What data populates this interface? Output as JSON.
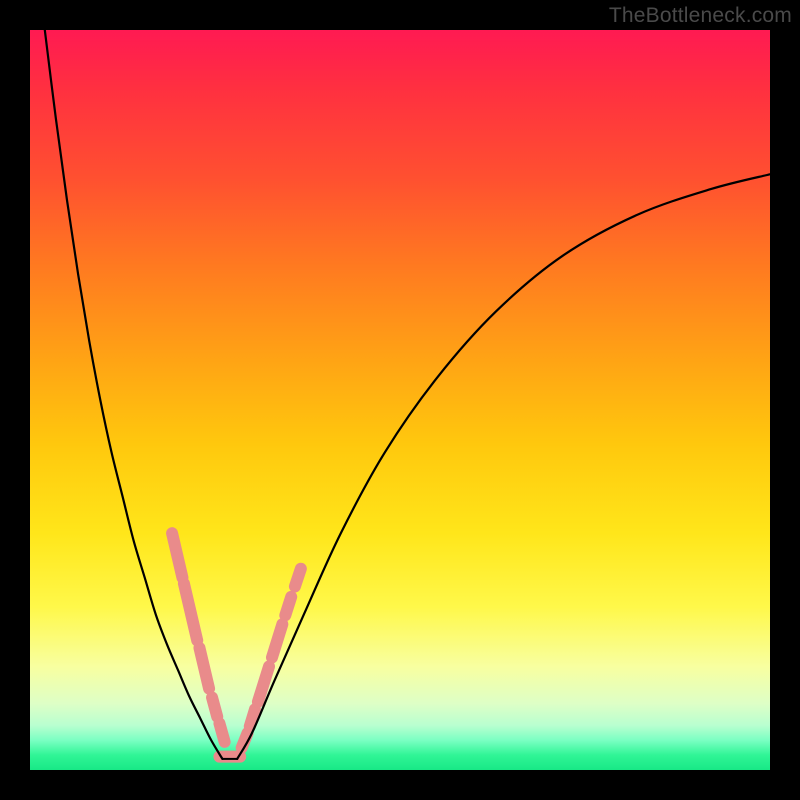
{
  "watermark": "TheBottleneck.com",
  "chart_data": {
    "type": "line",
    "title": "",
    "xlabel": "",
    "ylabel": "",
    "xlim": [
      0,
      100
    ],
    "ylim": [
      0,
      100
    ],
    "grid": false,
    "legend": false,
    "background_gradient_stops": [
      {
        "pos": 0.0,
        "color": "#ff1a52"
      },
      {
        "pos": 0.08,
        "color": "#ff3040"
      },
      {
        "pos": 0.2,
        "color": "#ff5030"
      },
      {
        "pos": 0.32,
        "color": "#ff7a20"
      },
      {
        "pos": 0.45,
        "color": "#ffa514"
      },
      {
        "pos": 0.56,
        "color": "#ffc80d"
      },
      {
        "pos": 0.68,
        "color": "#ffe61a"
      },
      {
        "pos": 0.78,
        "color": "#fff84a"
      },
      {
        "pos": 0.86,
        "color": "#f8ffa0"
      },
      {
        "pos": 0.91,
        "color": "#deffc6"
      },
      {
        "pos": 0.94,
        "color": "#b8ffd0"
      },
      {
        "pos": 0.96,
        "color": "#7affc2"
      },
      {
        "pos": 0.98,
        "color": "#30f596"
      },
      {
        "pos": 1.0,
        "color": "#18e886"
      }
    ],
    "series": [
      {
        "name": "left-branch",
        "stroke": "#000000",
        "stroke_width": 2.2,
        "x": [
          2.0,
          3.5,
          5.0,
          6.5,
          8.0,
          9.5,
          11.0,
          12.5,
          14.0,
          15.5,
          17.0,
          18.5,
          20.0,
          21.5,
          23.0,
          24.5,
          26.0
        ],
        "y": [
          100,
          88,
          77,
          67,
          58,
          50,
          43,
          37,
          31,
          26,
          21,
          17,
          13.5,
          10,
          7,
          4,
          1.5
        ]
      },
      {
        "name": "right-branch",
        "stroke": "#000000",
        "stroke_width": 2.2,
        "x": [
          28.0,
          30.0,
          33.0,
          37.0,
          42.0,
          48.0,
          55.0,
          63.0,
          72.0,
          82.0,
          92.0,
          100.0
        ],
        "y": [
          1.5,
          5.0,
          12.0,
          21.0,
          32.0,
          43.0,
          53.0,
          62.0,
          69.5,
          75.0,
          78.5,
          80.5
        ]
      }
    ],
    "floor": {
      "description": "flat connector along baseline between branches",
      "stroke": "#000000",
      "stroke_width": 2.0,
      "x": [
        26.0,
        28.0
      ],
      "y": [
        1.5,
        1.5
      ]
    },
    "markers": {
      "type": "rounded-segments",
      "color": "#e98b8b",
      "thickness": 12,
      "segments_along_left_branch": [
        {
          "x0": 19.2,
          "y0": 32.0,
          "x1": 20.6,
          "y1": 26.0
        },
        {
          "x0": 20.8,
          "y0": 25.2,
          "x1": 22.6,
          "y1": 17.5
        },
        {
          "x0": 22.9,
          "y0": 16.5,
          "x1": 24.2,
          "y1": 11.0
        },
        {
          "x0": 24.6,
          "y0": 9.8,
          "x1": 25.3,
          "y1": 7.2
        },
        {
          "x0": 25.6,
          "y0": 6.3,
          "x1": 26.3,
          "y1": 3.8
        }
      ],
      "segments_on_floor": [
        {
          "x0": 25.6,
          "y0": 1.8,
          "x1": 28.4,
          "y1": 1.8
        }
      ],
      "segments_along_right_branch": [
        {
          "x0": 28.6,
          "y0": 3.0,
          "x1": 29.4,
          "y1": 5.0
        },
        {
          "x0": 29.7,
          "y0": 5.9,
          "x1": 30.4,
          "y1": 8.2
        },
        {
          "x0": 30.8,
          "y0": 9.2,
          "x1": 32.3,
          "y1": 14.0
        },
        {
          "x0": 32.7,
          "y0": 15.2,
          "x1": 34.1,
          "y1": 19.7
        },
        {
          "x0": 34.5,
          "y0": 20.9,
          "x1": 35.3,
          "y1": 23.4
        },
        {
          "x0": 35.8,
          "y0": 24.8,
          "x1": 36.6,
          "y1": 27.2
        }
      ]
    }
  }
}
